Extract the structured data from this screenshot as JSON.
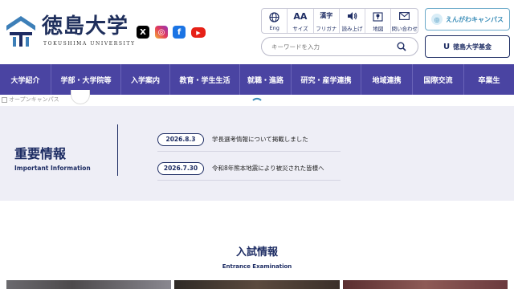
{
  "header": {
    "logo_text": "徳島大学",
    "logo_sub": "TOKUSHIMA UNIVERSITY",
    "sns": [
      {
        "icon": "x-icon",
        "glyph": "X"
      },
      {
        "icon": "instagram-icon",
        "glyph": "◎"
      },
      {
        "icon": "facebook-icon",
        "glyph": "f"
      },
      {
        "icon": "youtube-icon",
        "glyph": "▶"
      }
    ],
    "utilities": [
      {
        "label": "Eng",
        "icon": "globe-icon"
      },
      {
        "label": "サイズ",
        "glyph": "AA",
        "icon": "font-size-icon"
      },
      {
        "label": "フリガナ",
        "glyph": "漢字",
        "icon": "furigana-icon"
      },
      {
        "label": "読み上げ",
        "icon": "speaker-icon"
      },
      {
        "label": "地図",
        "icon": "map-icon"
      },
      {
        "label": "問い合わせ",
        "icon": "mail-icon"
      }
    ],
    "search_placeholder": "キーワードを入力",
    "campus_button": "えんがわキャンパス",
    "fund_button": "徳島大学基金",
    "fund_glyph": "U"
  },
  "nav": [
    {
      "label": "大学紹介",
      "width": 64
    },
    {
      "label": "学部・大学院等",
      "width": 87
    },
    {
      "label": "入学案内",
      "width": 61
    },
    {
      "label": "教育・学生生活",
      "width": 87
    },
    {
      "label": "就職・進路",
      "width": 64
    },
    {
      "label": "研究・産学連携",
      "width": 87
    },
    {
      "label": "地域連携",
      "width": 64
    },
    {
      "label": "国際交流",
      "width": 64
    },
    {
      "label": "卒業生",
      "width": 62
    }
  ],
  "banner": {
    "image_alt": "オープンキャンパス"
  },
  "important": {
    "title": "重要情報",
    "subtitle": "Important Information",
    "news": [
      {
        "date": "2026.8.3",
        "text": "学長選考情報について掲載しました"
      },
      {
        "date": "2026.7.30",
        "text": "令和8年熊本地震により被災された皆様へ"
      }
    ]
  },
  "admissions": {
    "title": "入試情報",
    "subtitle": "Entrance Examination"
  },
  "colors": {
    "nav_bg": "#4a44a2",
    "brand_navy": "#1d2c63",
    "important_bg": "#eeeef6",
    "campus_accent": "#3a8db8"
  }
}
